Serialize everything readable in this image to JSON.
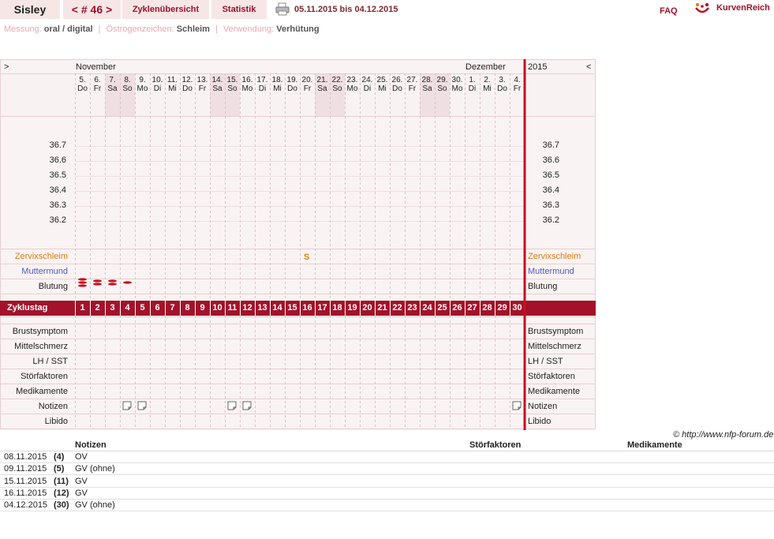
{
  "topbar": {
    "name": "Sisley",
    "cycle": "< # 46 >",
    "overview": "Zyklenübersicht",
    "statistics": "Statistik",
    "date_range": "05.11.2015 bis 04.12.2015",
    "faq": "FAQ",
    "brand": "KurvenReich"
  },
  "meta": {
    "measure_label": "Messung:",
    "measure_value": "oral / digital",
    "estrogen_label": "Östrogenzeichen:",
    "estrogen_value": "Schleim",
    "use_label": "Verwendung:",
    "use_value": "Verhütung"
  },
  "chart_data": {
    "type": "table",
    "nav_left": ">",
    "nav_right": "<",
    "months": [
      "November",
      "Dezember"
    ],
    "year": "2015",
    "days": [
      {
        "d": "5.",
        "w": "Do",
        "we": false
      },
      {
        "d": "6.",
        "w": "Fr",
        "we": false
      },
      {
        "d": "7.",
        "w": "Sa",
        "we": true
      },
      {
        "d": "8.",
        "w": "So",
        "we": true
      },
      {
        "d": "9.",
        "w": "Mo",
        "we": false
      },
      {
        "d": "10.",
        "w": "Di",
        "we": false
      },
      {
        "d": "11.",
        "w": "Mi",
        "we": false
      },
      {
        "d": "12.",
        "w": "Do",
        "we": false
      },
      {
        "d": "13.",
        "w": "Fr",
        "we": false
      },
      {
        "d": "14.",
        "w": "Sa",
        "we": true
      },
      {
        "d": "15.",
        "w": "So",
        "we": true
      },
      {
        "d": "16.",
        "w": "Mo",
        "we": false
      },
      {
        "d": "17.",
        "w": "Di",
        "we": false
      },
      {
        "d": "18.",
        "w": "Mi",
        "we": false
      },
      {
        "d": "19.",
        "w": "Do",
        "we": false
      },
      {
        "d": "20.",
        "w": "Fr",
        "we": false
      },
      {
        "d": "21.",
        "w": "Sa",
        "we": true
      },
      {
        "d": "22.",
        "w": "So",
        "we": true
      },
      {
        "d": "23.",
        "w": "Mo",
        "we": false
      },
      {
        "d": "24.",
        "w": "Di",
        "we": false
      },
      {
        "d": "25.",
        "w": "Mi",
        "we": false
      },
      {
        "d": "26.",
        "w": "Do",
        "we": false
      },
      {
        "d": "27.",
        "w": "Fr",
        "we": false
      },
      {
        "d": "28.",
        "w": "Sa",
        "we": true
      },
      {
        "d": "29.",
        "w": "So",
        "we": true
      },
      {
        "d": "30.",
        "w": "Mo",
        "we": false
      },
      {
        "d": "1.",
        "w": "Di",
        "we": false
      },
      {
        "d": "2.",
        "w": "Mi",
        "we": false
      },
      {
        "d": "3.",
        "w": "Do",
        "we": false
      },
      {
        "d": "4.",
        "w": "Fr",
        "we": false
      }
    ],
    "y_ticks": [
      "36.7",
      "36.6",
      "36.5",
      "36.4",
      "36.3",
      "36.2"
    ],
    "temperatures": [],
    "rows": {
      "cervix": "Zervixschleim",
      "cervix_marks": [
        {
          "cycle_day": 16,
          "symbol": "S"
        }
      ],
      "mouth": "Muttermund",
      "bleeding": "Blutung",
      "bleeding_levels": [
        3,
        2,
        2,
        1
      ],
      "cycle_label": "Zyklustag",
      "cycle_days": [
        1,
        2,
        3,
        4,
        5,
        6,
        7,
        8,
        9,
        10,
        11,
        12,
        13,
        14,
        15,
        16,
        17,
        18,
        19,
        20,
        21,
        22,
        23,
        24,
        25,
        26,
        27,
        28,
        29,
        30
      ],
      "breast": "Brustsymptom",
      "midpain": "Mittelschmerz",
      "lh": "LH / SST",
      "disturb": "Störfaktoren",
      "meds": "Medikamente",
      "notes": "Notizen",
      "note_days": [
        4,
        5,
        11,
        12,
        30
      ],
      "libido": "Libido"
    }
  },
  "copyright": "© http://www.nfp-forum.de",
  "notes_table": {
    "headers": [
      "Notizen",
      "Störfaktoren",
      "Medikamente"
    ],
    "rows": [
      {
        "date": "08.11.2015",
        "day": "(4)",
        "note": "OV"
      },
      {
        "date": "09.11.2015",
        "day": "(5)",
        "note": "GV (ohne)"
      },
      {
        "date": "15.11.2015",
        "day": "(11)",
        "note": "GV"
      },
      {
        "date": "16.11.2015",
        "day": "(12)",
        "note": "GV"
      },
      {
        "date": "04.12.2015",
        "day": "(30)",
        "note": "GV (ohne)"
      }
    ]
  }
}
